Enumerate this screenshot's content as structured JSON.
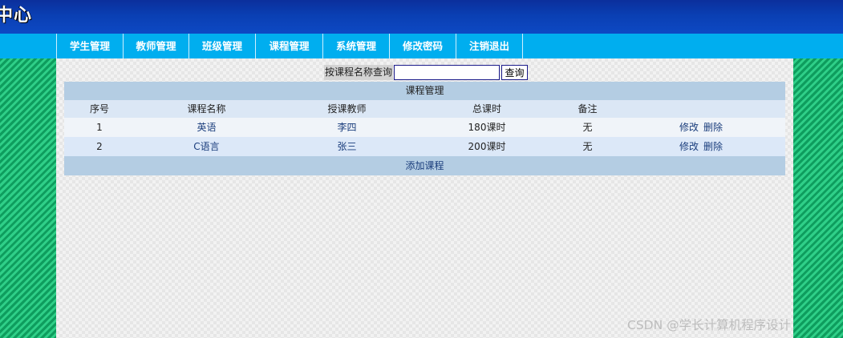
{
  "banner": {
    "title": "管理中心"
  },
  "nav": {
    "items": [
      {
        "label": "学生管理"
      },
      {
        "label": "教师管理"
      },
      {
        "label": "班级管理"
      },
      {
        "label": "课程管理"
      },
      {
        "label": "系统管理"
      },
      {
        "label": "修改密码"
      },
      {
        "label": "注销退出"
      }
    ]
  },
  "search": {
    "label": "按课程名称查询",
    "value": "",
    "button": "查询"
  },
  "table": {
    "caption": "课程管理",
    "headers": [
      "序号",
      "课程名称",
      "授课教师",
      "总课时",
      "备注",
      ""
    ],
    "rows": [
      {
        "no": "1",
        "name": "英语",
        "teacher": "李四",
        "hours": "180课时",
        "remark": "无",
        "edit": "修改",
        "delete": "删除"
      },
      {
        "no": "2",
        "name": "C语言",
        "teacher": "张三",
        "hours": "200课时",
        "remark": "无",
        "edit": "修改",
        "delete": "删除"
      }
    ],
    "add_label": "添加课程"
  },
  "watermark": "CSDN @学长计算机程序设计",
  "colors": {
    "banner": "#0a3fb3",
    "nav": "#00aeef",
    "side_stripe": "#0e9d5e",
    "caption_bg": "#b4cde3",
    "row_alt": "#dce8f8"
  }
}
